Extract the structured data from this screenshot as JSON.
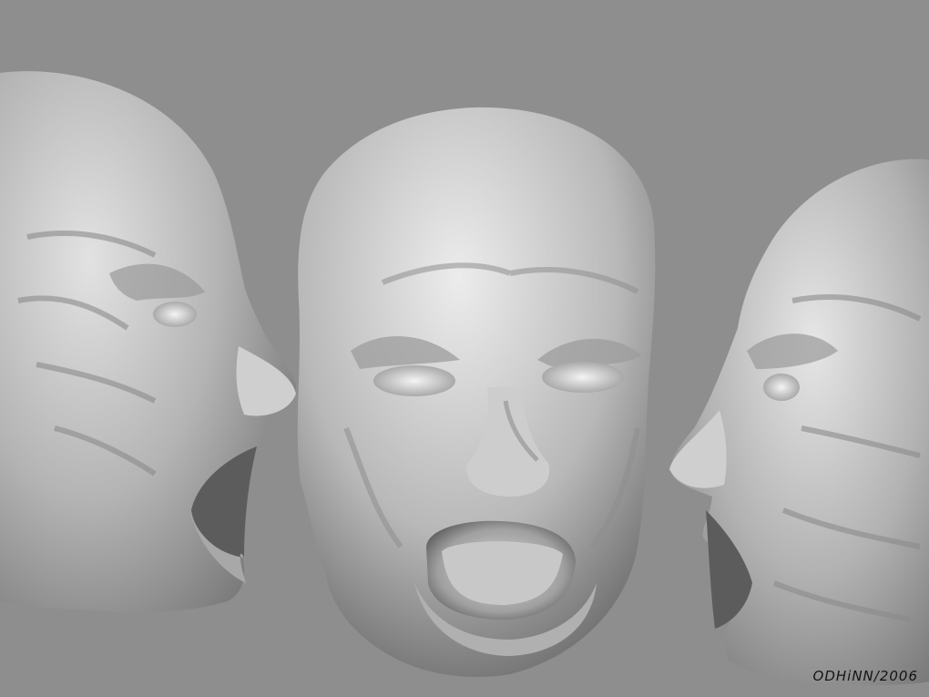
{
  "artwork": {
    "signature": "ODHiNN/2006",
    "background_color": "#8e8e8e",
    "subjects": [
      "left-screaming-head-profile",
      "center-screaming-head-front",
      "right-screaming-head-profile"
    ]
  }
}
